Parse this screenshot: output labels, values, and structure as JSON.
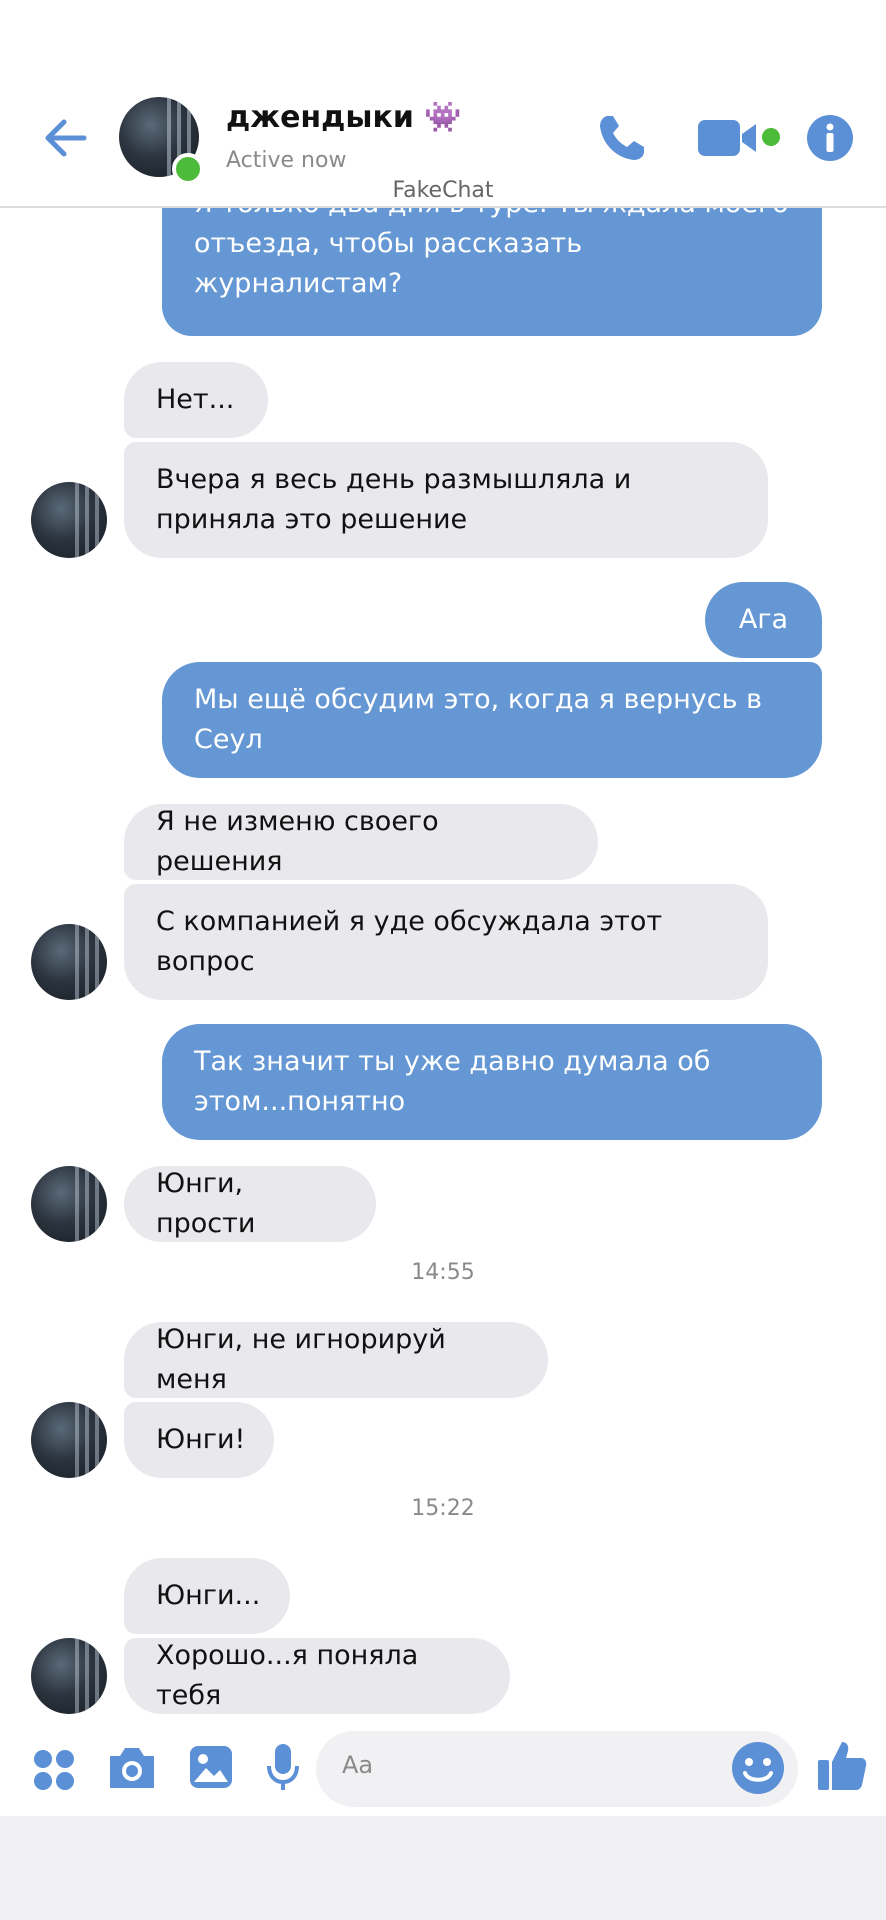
{
  "header": {
    "contact_name": "джендыки 👾",
    "status": "Active now",
    "watermark": "FakeChat"
  },
  "messages": [
    {
      "side": "out",
      "text": "Я только два дня в туре. Ты ждала моего отъезда, чтобы рассказать журналистам?"
    },
    {
      "side": "in",
      "text": "Нет..."
    },
    {
      "side": "in",
      "text": "Вчера я весь день размышляла и приняла это решение"
    },
    {
      "side": "out",
      "text": "Ага"
    },
    {
      "side": "out",
      "text": "Мы ещё обсудим это, когда я вернусь в Сеул"
    },
    {
      "side": "in",
      "text": "Я не изменю своего решения"
    },
    {
      "side": "in",
      "text": "С компанией я уде обсуждала этот вопрос"
    },
    {
      "side": "out",
      "text": "Так значит ты уже давно думала об этом...понятно"
    },
    {
      "side": "in",
      "text": "Юнги, прости"
    },
    {
      "side": "time",
      "text": "14:55"
    },
    {
      "side": "in",
      "text": "Юнги, не игнорируй меня"
    },
    {
      "side": "in",
      "text": "Юнги!"
    },
    {
      "side": "time",
      "text": "15:22"
    },
    {
      "side": "in",
      "text": "Юнги..."
    },
    {
      "side": "in",
      "text": "Хорошо...я поняла тебя"
    }
  ],
  "composer": {
    "placeholder": "Aa",
    "icons": [
      "apps-icon",
      "camera-icon",
      "image-icon",
      "microphone-icon",
      "emoji-icon",
      "thumbs-up-icon"
    ]
  },
  "colors": {
    "accent": "#5b8fd6",
    "outgoing_bubble": "#6497d4",
    "incoming_bubble": "#e9e8ec",
    "online": "#4cbb3a"
  }
}
